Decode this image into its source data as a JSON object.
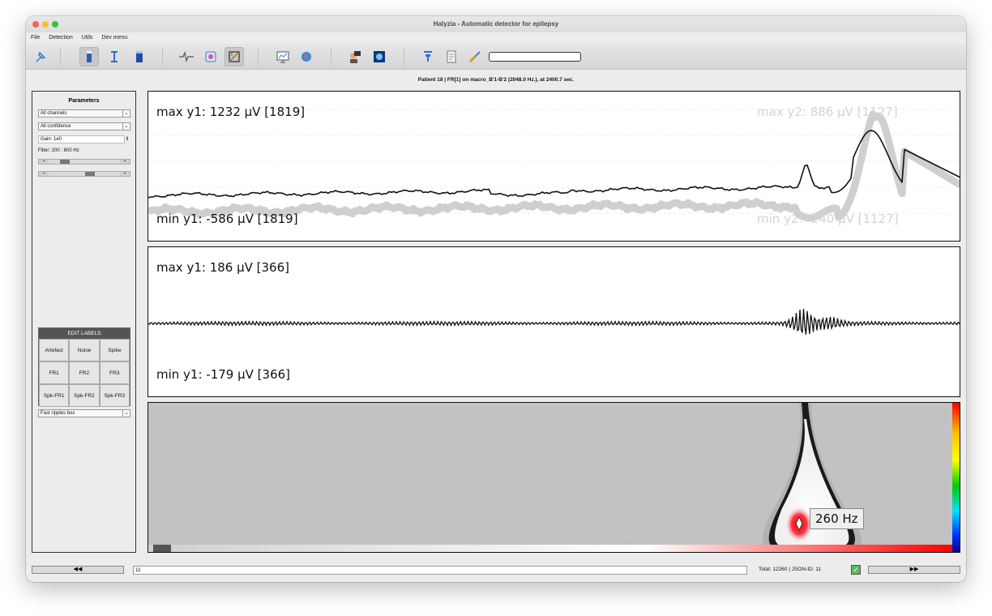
{
  "window": {
    "title": "Halyzia - Automatic detector for epilepsy"
  },
  "menu": [
    "File",
    "Detection",
    "Utils",
    "Dev menu"
  ],
  "toolbar": {
    "icons": [
      "pin-icon",
      "single-channel-icon",
      "cursor-icon",
      "multi-channel-icon",
      "waveform-icon",
      "brain-scan-icon",
      "montage-icon",
      "chart-icon",
      "globe-icon",
      "patient-icon",
      "mri-icon",
      "info-icon",
      "document-icon",
      "brush-icon"
    ],
    "progress_percent": 0
  },
  "info_line": "Patient 18   |   FR[1] on macro_B'1-B'2 (2048.0 Hz.), at 2400.7 sec.",
  "params": {
    "title": "Parameters",
    "channels": "All channels",
    "confidence": "All confidence",
    "gain": "Gain: 1e0",
    "filter": "Filter: 200 : 600 Hz"
  },
  "labels": {
    "header": "EDIT LABELS",
    "buttons": [
      "Artefact",
      "Noise",
      "Spike",
      "FR1",
      "FR2",
      "FR3",
      "Spk-FR1",
      "Spk-FR2",
      "Spk-FR3"
    ],
    "box_select": "Fast ripples box"
  },
  "raw_plot": {
    "max_y1": "max y1: 1232 µV [1819]",
    "min_y1": "min y1: -586 µV [1819]",
    "max_y2": "max y2: 886 µV [1127]",
    "min_y2": "min y2: -240 µV [1127]"
  },
  "filtered_plot": {
    "max_y1": "max y1: 186 µV [366]",
    "min_y1": "min y1: -179 µV [366]"
  },
  "spectrogram": {
    "peak_label": "260 Hz"
  },
  "bottom": {
    "prev": "◀◀",
    "next": "▶▶",
    "input": "11",
    "totals": "Total: 12260   |   JSON-ID: 11"
  }
}
